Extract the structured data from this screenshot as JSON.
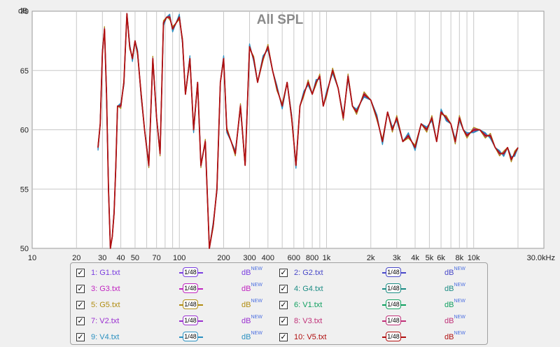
{
  "chart_data": {
    "type": "line",
    "title": "All SPL",
    "ylabel": "dB",
    "xlabel": "",
    "x_scale": "log",
    "xlim": [
      10,
      30000
    ],
    "ylim": [
      50,
      70
    ],
    "x_ticks": [
      {
        "v": 10,
        "label": "10"
      },
      {
        "v": 20,
        "label": "20"
      },
      {
        "v": 30,
        "label": "30"
      },
      {
        "v": 40,
        "label": "40"
      },
      {
        "v": 50,
        "label": "50"
      },
      {
        "v": 70,
        "label": "70"
      },
      {
        "v": 100,
        "label": "100"
      },
      {
        "v": 200,
        "label": "200"
      },
      {
        "v": 300,
        "label": "300"
      },
      {
        "v": 400,
        "label": "400"
      },
      {
        "v": 600,
        "label": "600"
      },
      {
        "v": 800,
        "label": "800"
      },
      {
        "v": 1000,
        "label": "1k"
      },
      {
        "v": 2000,
        "label": "2k"
      },
      {
        "v": 3000,
        "label": "3k"
      },
      {
        "v": 4000,
        "label": "4k"
      },
      {
        "v": 5000,
        "label": "5k"
      },
      {
        "v": 6000,
        "label": "6k"
      },
      {
        "v": 8000,
        "label": "8k"
      },
      {
        "v": 10000,
        "label": "10k"
      },
      {
        "v": 30000,
        "label": "30,0kHz"
      }
    ],
    "y_ticks": [
      {
        "v": 50,
        "label": "50"
      },
      {
        "v": 55,
        "label": "55"
      },
      {
        "v": 60,
        "label": "60"
      },
      {
        "v": 65,
        "label": "65"
      },
      {
        "v": 70,
        "label": "70"
      }
    ],
    "grid": true,
    "legend": "bottom",
    "base": {
      "x": [
        28,
        29,
        30,
        31,
        32,
        33,
        34,
        35,
        36,
        37,
        38,
        40,
        42,
        44,
        46,
        48,
        50,
        52,
        55,
        58,
        62,
        66,
        70,
        74,
        78,
        82,
        86,
        90,
        95,
        100,
        105,
        110,
        118,
        125,
        133,
        140,
        150,
        160,
        170,
        180,
        190,
        200,
        210,
        225,
        240,
        260,
        280,
        300,
        320,
        340,
        370,
        400,
        430,
        460,
        500,
        540,
        580,
        620,
        660,
        700,
        750,
        800,
        850,
        900,
        950,
        1000,
        1100,
        1200,
        1300,
        1400,
        1500,
        1600,
        1800,
        2000,
        2200,
        2400,
        2600,
        2800,
        3000,
        3300,
        3600,
        4000,
        4400,
        4800,
        5200,
        5600,
        6000,
        6500,
        7000,
        7500,
        8000,
        8500,
        9000,
        10000,
        11000,
        12000,
        13000,
        14000,
        15000,
        16000,
        17000,
        18000,
        19000,
        20000
      ],
      "y": [
        58.5,
        60.5,
        66.5,
        68.5,
        63,
        55,
        50,
        51,
        53,
        57,
        62,
        62,
        64,
        69.8,
        67,
        66,
        67.5,
        66.5,
        63,
        60,
        57,
        66,
        61,
        58,
        69,
        69.5,
        69.5,
        68.5,
        69,
        69.5,
        67.5,
        63,
        66,
        60,
        64,
        57,
        59,
        48,
        52,
        55,
        64,
        66,
        60,
        59,
        58,
        62,
        57,
        67,
        66,
        64,
        66,
        67,
        65,
        63.5,
        62,
        64,
        61,
        57,
        62,
        63,
        64,
        63,
        64,
        64.5,
        62,
        63,
        65,
        63.5,
        61,
        64.5,
        62,
        61.5,
        63,
        62.5,
        61,
        59,
        61.5,
        60,
        61,
        59,
        59.5,
        58.5,
        60.5,
        60,
        61,
        59,
        61.5,
        61,
        60.5,
        59,
        61,
        60,
        59.5,
        60,
        60,
        59.5,
        59.5,
        58.5,
        58,
        58,
        58.5,
        57.5,
        58,
        58.5
      ]
    },
    "series": [
      {
        "name": "1: G1.txt",
        "color": "#7a3fe0",
        "offset": 0.0
      },
      {
        "name": "2: G2.txt",
        "color": "#4848c8",
        "offset": 0.15
      },
      {
        "name": "3: G3.txt",
        "color": "#c024c0",
        "offset": -0.1
      },
      {
        "name": "4: G4.txt",
        "color": "#1c8c84",
        "offset": 0.1
      },
      {
        "name": "5: G5.txt",
        "color": "#b08c10",
        "offset": -0.2
      },
      {
        "name": "6: V1.txt",
        "color": "#10a060",
        "offset": 0.05
      },
      {
        "name": "7: V2.txt",
        "color": "#9a30d0",
        "offset": -0.05
      },
      {
        "name": "8: V3.txt",
        "color": "#c03078",
        "offset": 0.08
      },
      {
        "name": "9: V4.txt",
        "color": "#2a90c0",
        "offset": 0.25
      },
      {
        "name": "10: V5.txt",
        "color": "#b01010",
        "offset": 0.0
      }
    ]
  },
  "legend": {
    "smoothing_label": "1/48",
    "db_label": "dB",
    "new_label": "NEW",
    "check_mark": "✓"
  }
}
